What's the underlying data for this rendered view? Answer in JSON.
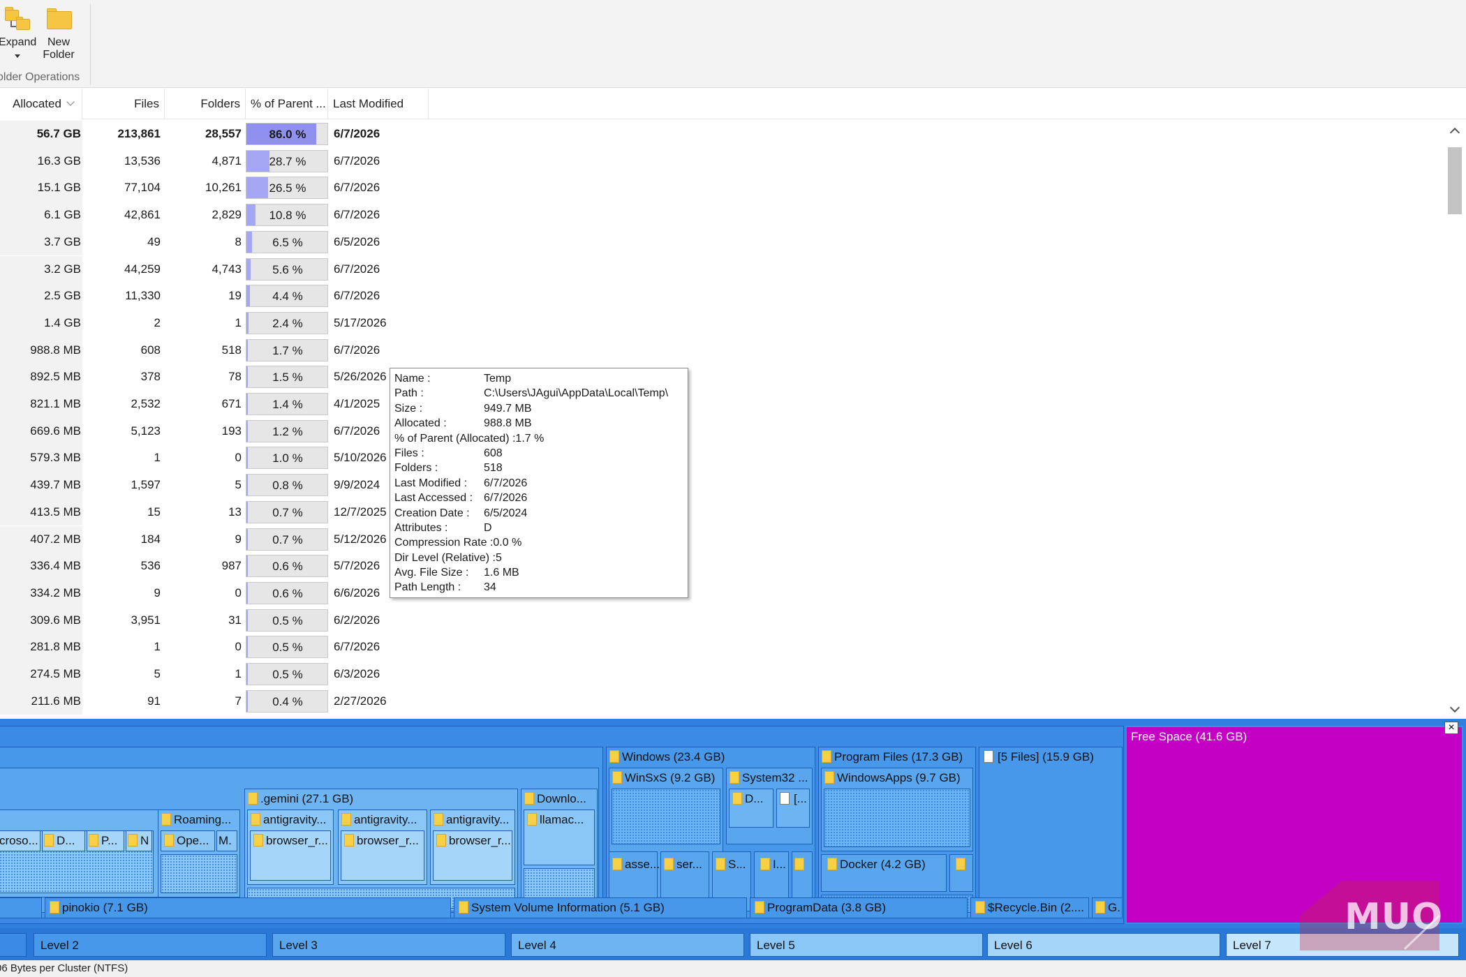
{
  "ribbon": {
    "expand_label": "Expand",
    "new_folder_line1": "New",
    "new_folder_line2": "Folder",
    "group_label": "older Operations"
  },
  "columns": {
    "allocated": "Allocated",
    "files": "Files",
    "folders": "Folders",
    "pct_parent": "% of Parent ...",
    "last_modified": "Last Modified"
  },
  "rows": [
    {
      "allocated": "56.7 GB",
      "files": "213,861",
      "folders": "28,557",
      "pct": "86.0 %",
      "pct_value": 86.0,
      "modified": "6/7/2026",
      "bold": true
    },
    {
      "allocated": "16.3 GB",
      "files": "13,536",
      "folders": "4,871",
      "pct": "28.7 %",
      "pct_value": 28.7,
      "modified": "6/7/2026"
    },
    {
      "allocated": "15.1 GB",
      "files": "77,104",
      "folders": "10,261",
      "pct": "26.5 %",
      "pct_value": 26.5,
      "modified": "6/7/2026"
    },
    {
      "allocated": "6.1 GB",
      "files": "42,861",
      "folders": "2,829",
      "pct": "10.8 %",
      "pct_value": 10.8,
      "modified": "6/7/2026"
    },
    {
      "allocated": "3.7 GB",
      "files": "49",
      "folders": "8",
      "pct": "6.5 %",
      "pct_value": 6.5,
      "modified": "6/5/2026"
    },
    {
      "allocated": "3.2 GB",
      "files": "44,259",
      "folders": "4,743",
      "pct": "5.6 %",
      "pct_value": 5.6,
      "modified": "6/7/2026"
    },
    {
      "allocated": "2.5 GB",
      "files": "11,330",
      "folders": "19",
      "pct": "4.4 %",
      "pct_value": 4.4,
      "modified": "6/7/2026"
    },
    {
      "allocated": "1.4 GB",
      "files": "2",
      "folders": "1",
      "pct": "2.4 %",
      "pct_value": 2.4,
      "modified": "5/17/2026"
    },
    {
      "allocated": "988.8 MB",
      "files": "608",
      "folders": "518",
      "pct": "1.7 %",
      "pct_value": 1.7,
      "modified": "6/7/2026"
    },
    {
      "allocated": "892.5 MB",
      "files": "378",
      "folders": "78",
      "pct": "1.5 %",
      "pct_value": 1.5,
      "modified": "5/26/2026"
    },
    {
      "allocated": "821.1 MB",
      "files": "2,532",
      "folders": "671",
      "pct": "1.4 %",
      "pct_value": 1.4,
      "modified": "4/1/2025"
    },
    {
      "allocated": "669.6 MB",
      "files": "5,123",
      "folders": "193",
      "pct": "1.2 %",
      "pct_value": 1.2,
      "modified": "6/7/2026"
    },
    {
      "allocated": "579.3 MB",
      "files": "1",
      "folders": "0",
      "pct": "1.0 %",
      "pct_value": 1.0,
      "modified": "5/10/2026"
    },
    {
      "allocated": "439.7 MB",
      "files": "1,597",
      "folders": "5",
      "pct": "0.8 %",
      "pct_value": 0.8,
      "modified": "9/9/2024"
    },
    {
      "allocated": "413.5 MB",
      "files": "15",
      "folders": "13",
      "pct": "0.7 %",
      "pct_value": 0.7,
      "modified": "12/7/2025"
    },
    {
      "allocated": "407.2 MB",
      "files": "184",
      "folders": "9",
      "pct": "0.7 %",
      "pct_value": 0.7,
      "modified": "5/12/2026"
    },
    {
      "allocated": "336.4 MB",
      "files": "536",
      "folders": "987",
      "pct": "0.6 %",
      "pct_value": 0.6,
      "modified": "5/7/2026"
    },
    {
      "allocated": "334.2 MB",
      "files": "9",
      "folders": "0",
      "pct": "0.6 %",
      "pct_value": 0.6,
      "modified": "6/6/2026"
    },
    {
      "allocated": "309.6 MB",
      "files": "3,951",
      "folders": "31",
      "pct": "0.5 %",
      "pct_value": 0.5,
      "modified": "6/2/2026"
    },
    {
      "allocated": "281.8 MB",
      "files": "1",
      "folders": "0",
      "pct": "0.5 %",
      "pct_value": 0.5,
      "modified": "6/7/2026"
    },
    {
      "allocated": "274.5 MB",
      "files": "5",
      "folders": "1",
      "pct": "0.5 %",
      "pct_value": 0.5,
      "modified": "6/3/2026"
    },
    {
      "allocated": "211.6 MB",
      "files": "91",
      "folders": "7",
      "pct": "0.4 %",
      "pct_value": 0.4,
      "modified": "2/27/2026"
    }
  ],
  "tooltip": {
    "name_k": "Name :",
    "name_v": "Temp",
    "path_k": "Path :",
    "path_v": "C:\\Users\\JAgui\\AppData\\Local\\Temp\\",
    "size_k": "Size :",
    "size_v": "949.7 MB",
    "alloc_k": "Allocated :",
    "alloc_v": "988.8 MB",
    "pct_k": "% of Parent (Allocated) :",
    "pct_v": "1.7 %",
    "files_k": "Files :",
    "files_v": "608",
    "folders_k": "Folders :",
    "folders_v": "518",
    "lastmod_k": "Last Modified :",
    "lastmod_v": "6/7/2026",
    "lastacc_k": "Last Accessed :",
    "lastacc_v": "6/7/2026",
    "created_k": "Creation Date :",
    "created_v": "6/5/2024",
    "attr_k": "Attributes :",
    "attr_v": "D",
    "comp_k": "Compression Rate :",
    "comp_v": "0.0 %",
    "dir_k": "Dir Level (Relative) :",
    "dir_v": "5",
    "avg_k": "Avg. File Size :",
    "avg_v": "1.6 MB",
    "pathlen_k": "Path Length :",
    "pathlen_v": "34"
  },
  "treemap": {
    "gemini": ".gemini (27.1 GB)",
    "roaming": "Roaming...",
    "ope": "Ope...",
    "m_short": "M.",
    "croso": "croso...",
    "d_short": "D...",
    "p_short": "P...",
    "n_short": "N",
    "antigravity1": "antigravity...",
    "antigravity2": "antigravity...",
    "antigravity3": "antigravity...",
    "browser1": "browser_r...",
    "browser2": "browser_r...",
    "browser3": "browser_r...",
    "downlo": "Downlo...",
    "llamac": "llamac...",
    "windows": "Windows (23.4 GB)",
    "winsxs": "WinSxS (9.2 GB)",
    "system32": "System32 ...",
    "d_win": "D...",
    "bracket": "[...",
    "asse": "asse...",
    "ser": "ser...",
    "s_short": "S...",
    "i_short": "I...",
    "program_files": "Program Files (17.3 GB)",
    "windowsapps": "WindowsApps (9.7 GB)",
    "docker": "Docker (4.2 GB)",
    "files5": "[5 Files] (15.9 GB)",
    "free_space": "Free Space (41.6 GB)",
    "pinokio": "pinokio (7.1 GB)",
    "svi": "System Volume Information (5.1 GB)",
    "programdata": "ProgramData (3.8 GB)",
    "recycle": "$Recycle.Bin (2....",
    "g_short": "G.",
    "close": "×"
  },
  "legend": [
    "Level 2",
    "Level 3",
    "Level 4",
    "Level 5",
    "Level 6",
    "Level 7"
  ],
  "watermark": "MUO",
  "status": "06 Bytes per Cluster (NTFS)",
  "colors": {
    "free_space": "#c400c4",
    "pct_bar": "#a5a6f4",
    "treemap_base": "#2e7fe0",
    "folder": "#f7d046"
  }
}
